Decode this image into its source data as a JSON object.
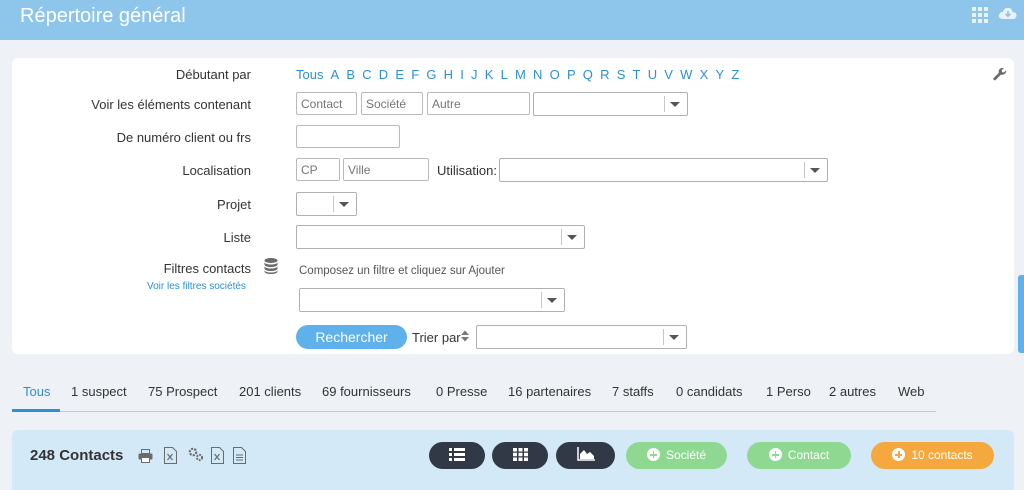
{
  "header": {
    "title": "Répertoire général",
    "apps_icon": "grid-apps-icon",
    "cloud_icon": "cloud-download-icon"
  },
  "filters": {
    "starting_label": "Débutant par",
    "letters": [
      "Tous",
      "A",
      "B",
      "C",
      "D",
      "E",
      "F",
      "G",
      "H",
      "I",
      "J",
      "K",
      "L",
      "M",
      "N",
      "O",
      "P",
      "Q",
      "R",
      "S",
      "T",
      "U",
      "V",
      "W",
      "X",
      "Y",
      "Z"
    ],
    "contains_label": "Voir les éléments contenant",
    "contact_placeholder": "Contact",
    "societe_placeholder": "Société",
    "autre_placeholder": "Autre",
    "client_number_label": "De numéro client ou frs",
    "location_label": "Localisation",
    "cp_placeholder": "CP",
    "ville_placeholder": "Ville",
    "usage_label": "Utilisation:",
    "project_label": "Projet",
    "list_label": "Liste",
    "contact_filters_label": "Filtres contacts",
    "company_filters_link": "Voir les filtres sociétés",
    "filter_hint": "Composez un filtre et cliquez sur Ajouter",
    "search_button": "Rechercher",
    "sort_label": "Trier par"
  },
  "tabs": [
    {
      "label": "Tous",
      "active": true
    },
    {
      "label": "1 suspect"
    },
    {
      "label": "75 Prospect"
    },
    {
      "label": "201 clients"
    },
    {
      "label": "69 fournisseurs"
    },
    {
      "label": "0 Presse"
    },
    {
      "label": "16 partenaires"
    },
    {
      "label": "7 staffs"
    },
    {
      "label": "0 candidats"
    },
    {
      "label": "1 Perso"
    },
    {
      "label": "2 autres"
    },
    {
      "label": "Web"
    }
  ],
  "results": {
    "count_label": "248 Contacts",
    "add_company": "Société",
    "add_contact": "Contact",
    "selection_contacts": "10 contacts"
  },
  "colors": {
    "header": "#8ec5ea",
    "accent": "#2d8fd5",
    "green": "#8fd892",
    "orange": "#f4a83d",
    "dark": "#313846"
  }
}
